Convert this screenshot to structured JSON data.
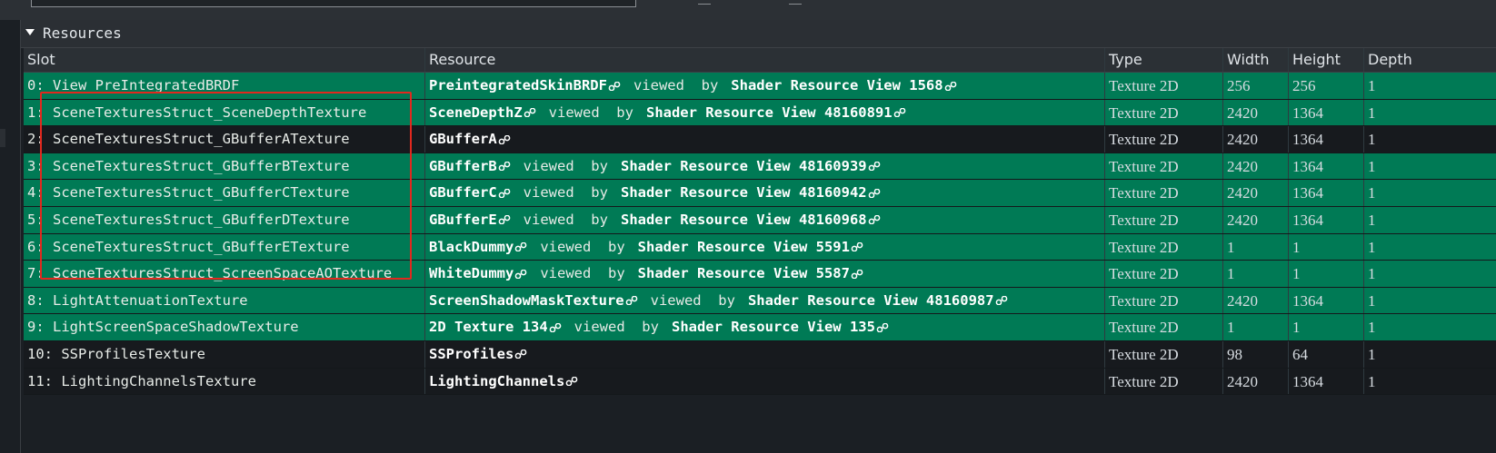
{
  "panel": {
    "title": "Resources"
  },
  "columns": [
    "Slot",
    "Resource",
    "Type",
    "Width",
    "Height",
    "Depth"
  ],
  "rows": [
    {
      "slot": "0: View_PreIntegratedBRDF",
      "resource": "PreintegratedSkinBRDF",
      "mid": "viewed  by",
      "view": "Shader Resource View 1568",
      "type": "Texture 2D",
      "width": "256",
      "height": "256",
      "depth": "1",
      "style": "green"
    },
    {
      "slot": "1: SceneTexturesStruct_SceneDepthTexture",
      "resource": "SceneDepthZ",
      "mid": "viewed  by",
      "view": "Shader Resource View 48160891",
      "type": "Texture 2D",
      "width": "2420",
      "height": "1364",
      "depth": "1",
      "style": "green"
    },
    {
      "slot": "2: SceneTexturesStruct_GBufferATexture",
      "resource": "GBufferA",
      "mid": "",
      "view": "",
      "type": "Texture 2D",
      "width": "2420",
      "height": "1364",
      "depth": "1",
      "style": "dark"
    },
    {
      "slot": "3: SceneTexturesStruct_GBufferBTexture",
      "resource": "GBufferB",
      "mid": "viewed  by",
      "view": "Shader Resource View 48160939",
      "type": "Texture 2D",
      "width": "2420",
      "height": "1364",
      "depth": "1",
      "style": "green"
    },
    {
      "slot": "4: SceneTexturesStruct_GBufferCTexture",
      "resource": "GBufferC",
      "mid": "viewed  by",
      "view": "Shader Resource View 48160942",
      "type": "Texture 2D",
      "width": "2420",
      "height": "1364",
      "depth": "1",
      "style": "green"
    },
    {
      "slot": "5: SceneTexturesStruct_GBufferDTexture",
      "resource": "GBufferE",
      "mid": "viewed  by",
      "view": "Shader Resource View 48160968",
      "type": "Texture 2D",
      "width": "2420",
      "height": "1364",
      "depth": "1",
      "style": "green"
    },
    {
      "slot": "6: SceneTexturesStruct_GBufferETexture",
      "resource": "BlackDummy",
      "mid": "viewed  by",
      "view": "Shader Resource View 5591",
      "type": "Texture 2D",
      "width": "1",
      "height": "1",
      "depth": "1",
      "style": "green"
    },
    {
      "slot": "7: SceneTexturesStruct_ScreenSpaceAOTexture",
      "resource": "WhiteDummy",
      "mid": "viewed  by",
      "view": "Shader Resource View 5587",
      "type": "Texture 2D",
      "width": "1",
      "height": "1",
      "depth": "1",
      "style": "green"
    },
    {
      "slot": "8: LightAttenuationTexture",
      "resource": "ScreenShadowMaskTexture",
      "mid": "viewed  by",
      "view": "Shader Resource View 48160987",
      "type": "Texture 2D",
      "width": "2420",
      "height": "1364",
      "depth": "1",
      "style": "green"
    },
    {
      "slot": "9: LightScreenSpaceShadowTexture",
      "resource": "2D Texture 134",
      "mid": "viewed  by",
      "view": "Shader Resource View 135",
      "type": "Texture 2D",
      "width": "1",
      "height": "1",
      "depth": "1",
      "style": "green"
    },
    {
      "slot": "10: SSProfilesTexture",
      "resource": "SSProfiles",
      "mid": "",
      "view": "",
      "type": "Texture 2D",
      "width": "98",
      "height": "64",
      "depth": "1",
      "style": "dark"
    },
    {
      "slot": "11: LightingChannelsTexture",
      "resource": "LightingChannels",
      "mid": "",
      "view": "",
      "type": "Texture 2D",
      "width": "2420",
      "height": "1364",
      "depth": "1",
      "style": "dark"
    }
  ],
  "colors": {
    "green_row": "#007a55",
    "dark_row": "#171a1e",
    "highlight": "#e2281e"
  }
}
